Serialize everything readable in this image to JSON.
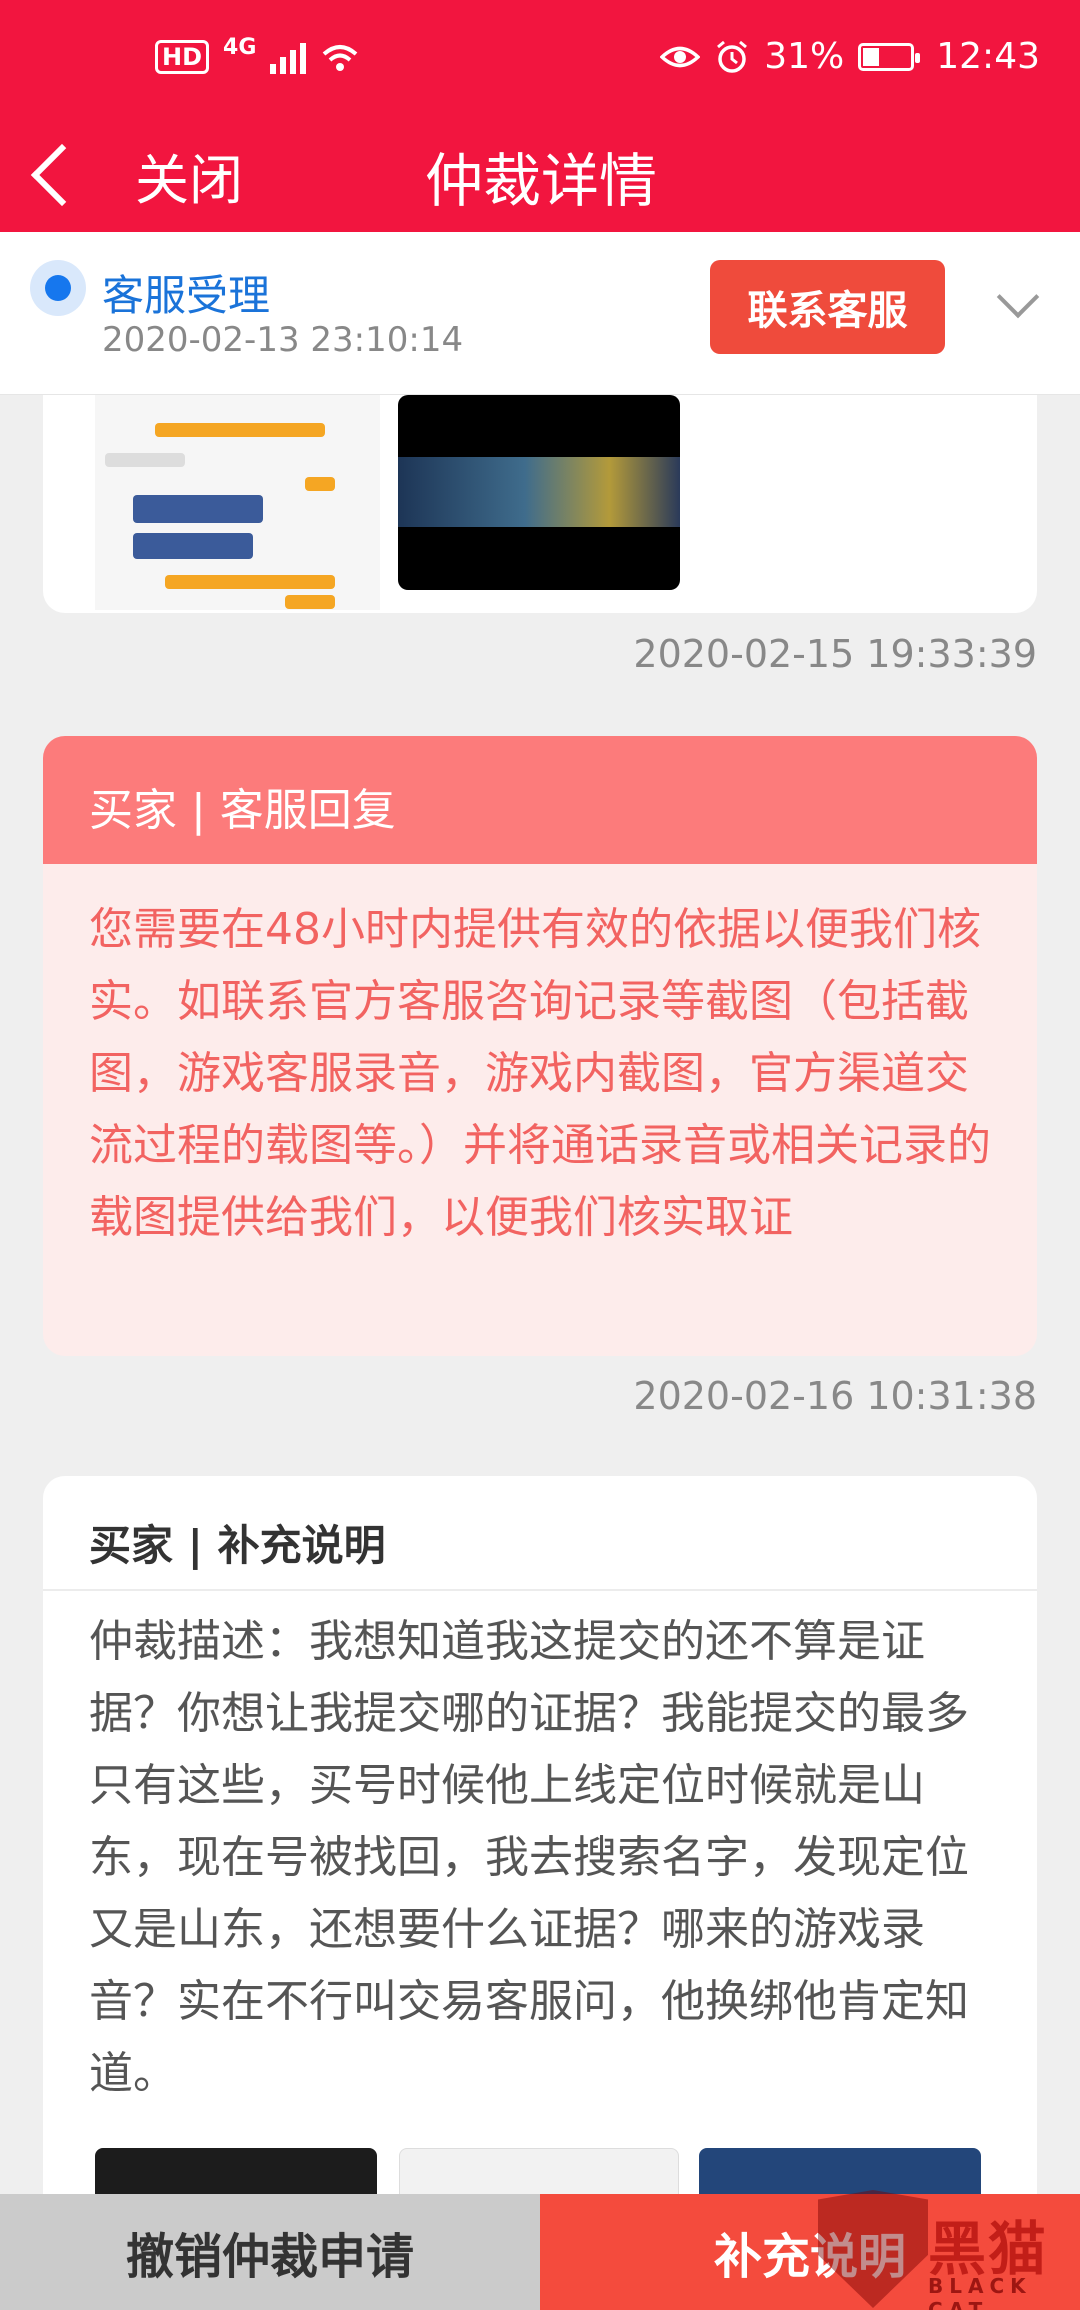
{
  "status_bar": {
    "hd": "HD",
    "network": "4G",
    "battery": "31%",
    "battery_level": 0.31,
    "time": "12:43"
  },
  "nav": {
    "close_label": "关闭",
    "title": "仲裁详情"
  },
  "stage": {
    "label": "客服受理",
    "time": "2020-02-13 23:10:14",
    "contact_button": "联系客服"
  },
  "messages": [
    {
      "timestamp": "2020-02-15 19:33:39"
    },
    {
      "header": "买家 | 客服回复",
      "body": "您需要在48小时内提供有效的依据以便我们核实。如联系官方客服咨询记录等截图（包括截图，游戏客服录音，游戏内截图，官方渠道交流过程的载图等。）并将通话录音或相关记录的载图提供给我们，以便我们核实取证",
      "timestamp": "2020-02-16 10:31:38"
    },
    {
      "header": "买家 | 补充说明",
      "body": "仲裁描述：我想知道我这提交的还不算是证据？你想让我提交哪的证据？我能提交的最多只有这些，买号时候他上线定位时候就是山东，现在号被找回，我去搜索名字，发现定位又是山东，还想要什么证据？哪来的游戏录音？实在不行叫交易客服问，他换绑他肯定知道。"
    }
  ],
  "bottom": {
    "cancel_label": "撤销仲裁申请",
    "supplement_label": "补充说明"
  },
  "watermark": {
    "text": "黑猫",
    "sub": "BLACK CAT"
  }
}
